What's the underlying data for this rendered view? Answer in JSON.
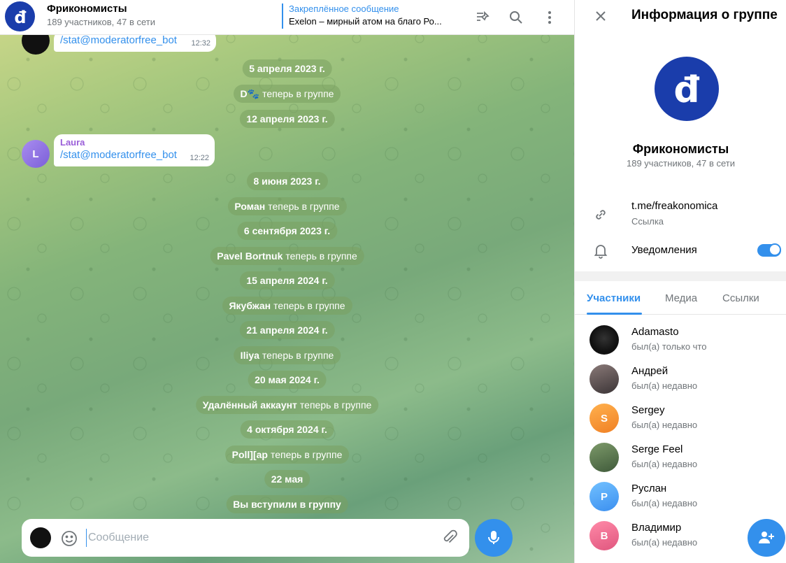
{
  "header": {
    "group_name": "Фрикономисты",
    "group_subtitle": "189 участников, 47 в сети",
    "pinned_label": "Закреплённое сообщение",
    "pinned_text": "Exelon – мирный атом на благо Ро...",
    "icons": [
      "pin-list-icon",
      "search-icon",
      "more-vertical-icon"
    ]
  },
  "messages": {
    "bubble_top": {
      "text": "/stat@moderatorfree_bot",
      "time": "12:32"
    },
    "pill_1": "5 апреля 2023 г.",
    "pill_2_name": "D🐾",
    "pill_2_action": "теперь в группе",
    "pill_3": "12 апреля 2023 г.",
    "bubble_laura": {
      "author": "Laura",
      "avatar_letter": "L",
      "text": "/stat@moderatorfree_bot",
      "time": "12:22"
    },
    "pill_4": "8 июня 2023 г.",
    "pill_5_name": "Роман",
    "pill_5_action": "теперь в группе",
    "pill_6": "6 сентября 2023 г.",
    "pill_7_name": "Pavel Bortnuk",
    "pill_7_action": "теперь в группе",
    "pill_8": "15 апреля 2024 г.",
    "pill_9_name": "Якубжан",
    "pill_9_action": "теперь в группе",
    "pill_10": "21 апреля 2024 г.",
    "pill_11_name": "Iliya",
    "pill_11_action": "теперь в группе",
    "pill_12": "20 мая 2024 г.",
    "pill_13_name": "Удалённый аккаунт",
    "pill_13_action": "теперь в группе",
    "pill_14": "4 октября 2024 г.",
    "pill_15_name": "Poll][ap",
    "pill_15_action": "теперь в группе",
    "pill_16": "22 мая",
    "pill_17": "Вы вступили в группу"
  },
  "composer": {
    "placeholder": "Сообщение"
  },
  "panel": {
    "title": "Информация о группе",
    "group_name": "Фрикономисты",
    "group_subtitle": "189 участников, 47 в сети",
    "link": "t.me/freakonomica",
    "link_caption": "Ссылка",
    "notifications_label": "Уведомления",
    "notifications_on": true,
    "tabs": [
      "Участники",
      "Медиа",
      "Ссылки"
    ],
    "members": [
      {
        "name": "Adamasto",
        "status": "был(а) только что"
      },
      {
        "name": "Андрей",
        "status": "был(а) недавно"
      },
      {
        "name": "Sergey",
        "status": "был(а) недавно",
        "letter": "S",
        "color": "#f5a623"
      },
      {
        "name": "Serge Feel",
        "status": "был(а) недавно"
      },
      {
        "name": "Руслан",
        "status": "был(а) недавно",
        "letter": "Р",
        "color": "#4a9ff5"
      },
      {
        "name": "Владимир",
        "status": "был(а) недавно",
        "letter": "В",
        "color": "#e8618c"
      }
    ]
  },
  "colors": {
    "accent": "#3390ec",
    "group_avatar": "#1a3dab",
    "author": "#9a5ed8"
  }
}
